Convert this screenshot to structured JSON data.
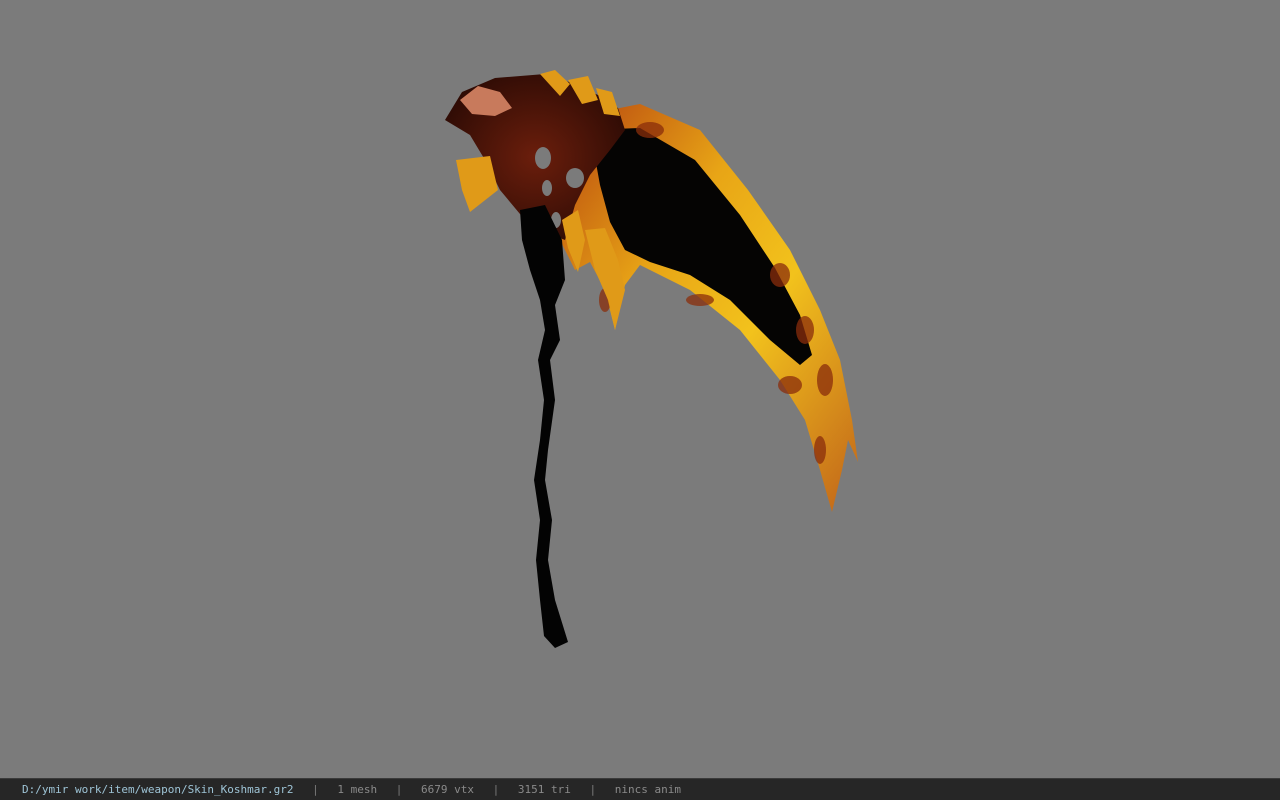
{
  "viewer": {
    "background_color": "#7b7b7b",
    "model_icon": "scythe-model"
  },
  "status": {
    "file_path": "D:/ymir work/item/weapon/Skin_Koshmar.gr2",
    "separator": "|",
    "meshes": "1 mesh",
    "vertices": "6679 vtx",
    "triangles": "3151 tri",
    "animation": "nincs anim"
  }
}
